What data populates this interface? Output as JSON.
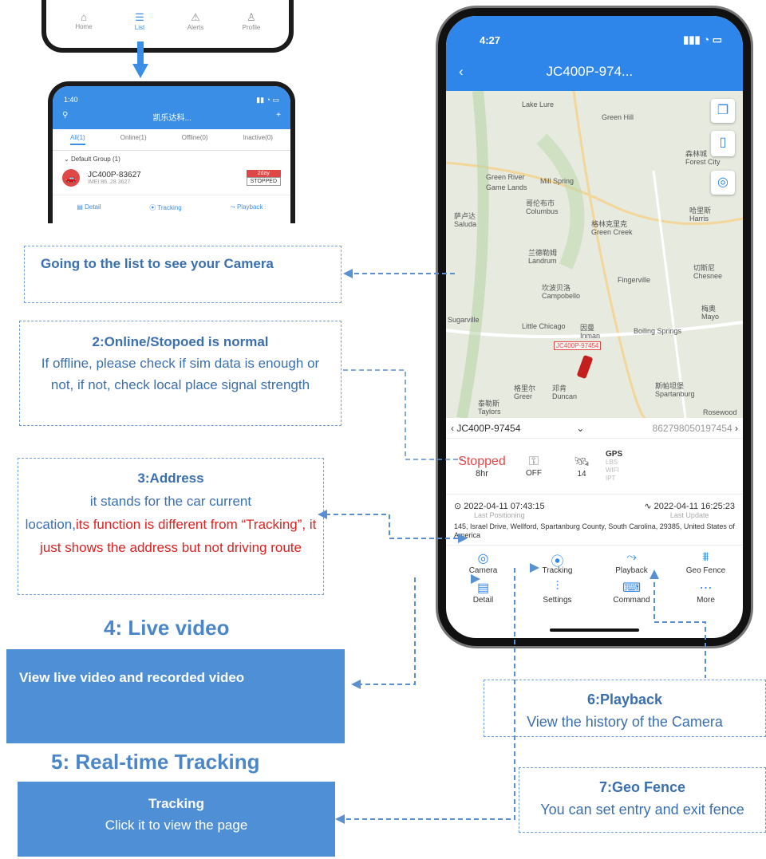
{
  "phone_top": {
    "tabs": [
      {
        "label": "Home",
        "icon": "home-icon"
      },
      {
        "label": "List",
        "icon": "list-icon"
      },
      {
        "label": "Alerts",
        "icon": "alert-icon"
      },
      {
        "label": "Profile",
        "icon": "profile-icon"
      }
    ]
  },
  "phone_list": {
    "time": "1:40",
    "title": "凯乐达科...",
    "tabs": [
      "All(1)",
      "Online(1)",
      "Offline(0)",
      "Inactive(0)"
    ],
    "group": "Default Group (1)",
    "device_name": "JC400P-83627",
    "device_sub": "IMEI:86..28 3627",
    "badge_day": "2day",
    "badge_status": "STOPPED",
    "actions": [
      "Detail",
      "Tracking",
      "Playback"
    ]
  },
  "phone_main": {
    "time": "4:27",
    "title": "JC400P-974...",
    "map_towns": [
      "Lake Lure",
      "Green Hill",
      "Green River",
      "Game Lands",
      "Mill Spring",
      "哥伦布市",
      "Columbus",
      "萨卢达",
      "Saluda",
      "格林克里克",
      "Green Creek",
      "兰德勒姆",
      "Landrum",
      "坎波贝洛",
      "Campobello",
      "Fingerville",
      "Little Chicago",
      "因曼",
      "Inman",
      "Boiling Springs",
      "格里尔",
      "Greer",
      "邓肯",
      "Duncan",
      "斯帕坦堡",
      "Spartanburg",
      "泰勒斯",
      "Taylors",
      "森林城",
      "Forest City",
      "哈里斯",
      "Harris",
      "切斯尼",
      "Chesnee",
      "梅奥",
      "Mayo",
      "Rosewood",
      "Sugarville"
    ],
    "map_car_label": "JC400P-97454",
    "device_name": "JC400P-97454",
    "imei": "862798050197454",
    "status": "Stopped",
    "status_duration": "8hr",
    "acc": "OFF",
    "satellites": "14",
    "sources": [
      "GPS",
      "LBS",
      "WIFI",
      "IPT"
    ],
    "positioning_time": "2022-04-11 07:43:15",
    "positioning_label": "Last Positioning",
    "update_time": "2022-04-11 16:25:23",
    "update_label": "Last Update",
    "address": "145, Israel Drive, Wellford, Spartanburg County, South Carolina, 29385, United States of America",
    "functions": [
      {
        "label": "Camera",
        "icon": "camera-icon"
      },
      {
        "label": "Tracking",
        "icon": "location-pin-icon"
      },
      {
        "label": "Playback",
        "icon": "route-icon"
      },
      {
        "label": "Geo Fence",
        "icon": "fence-icon"
      },
      {
        "label": "Detail",
        "icon": "document-icon"
      },
      {
        "label": "Settings",
        "icon": "sliders-icon"
      },
      {
        "label": "Command",
        "icon": "terminal-icon"
      },
      {
        "label": "More",
        "icon": "more-icon"
      }
    ]
  },
  "callouts": {
    "list_title": "Going to the list to see your Camera",
    "online_title": "2:Online/Stopoed is normal",
    "online_body": "If offline, please check if sim data is enough or not, if not, check local place signal strength",
    "address_title": "3:Address",
    "address_body_a": "it stands for the car current",
    "address_body_b": "location,",
    "address_body_c": "its function is different from “Tracking”, it just shows the address but not driving route",
    "live_heading": "4: Live video",
    "live_body": "View live video and recorded video",
    "tracking_heading": "5: Real-time Tracking",
    "tracking_title": "Tracking",
    "tracking_body": "Click it to view the page",
    "playback_title": "6:Playback",
    "playback_body": "View the history of the Camera",
    "geofence_title": "7:Geo Fence",
    "geofence_body": "You can set entry and exit fence"
  },
  "colors": {
    "accent": "#2f86ea",
    "callout_fill": "#4f8fd6",
    "text_blue": "#3a6fb0",
    "warn_red": "#e02020"
  }
}
